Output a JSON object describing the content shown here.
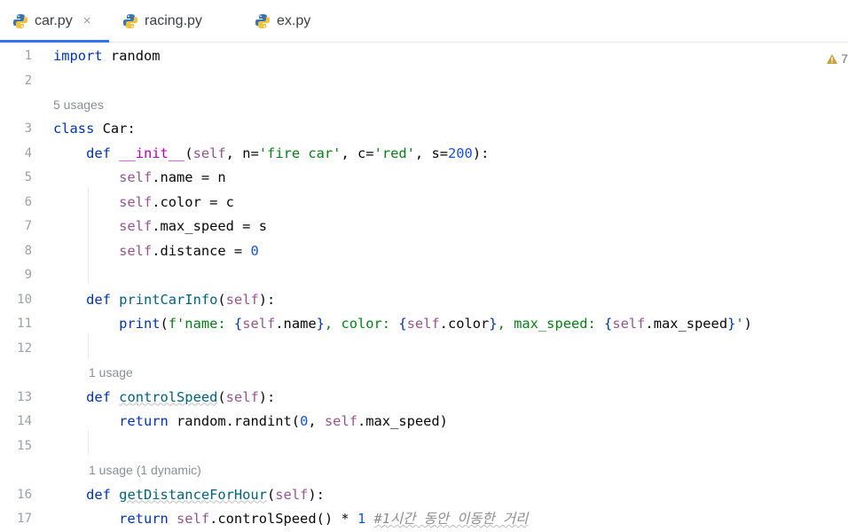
{
  "tabs": [
    {
      "label": "car.py",
      "active": true,
      "close": "×"
    },
    {
      "label": "racing.py",
      "active": false
    },
    {
      "label": "ex.py",
      "active": false
    }
  ],
  "warnings": {
    "count": "7"
  },
  "hints": {
    "class_car": "5 usages",
    "controlSpeed": "1 usage",
    "getDistanceForHour": "1 usage (1 dynamic)"
  },
  "code": {
    "import": "import",
    "random_mod": "random",
    "class_kw": "class",
    "class_name": "Car",
    "def_kw": "def",
    "init_name": "__init__",
    "self": "self",
    "param_n": "n",
    "str_fire_car": "'fire car'",
    "param_c": "c",
    "str_red": "'red'",
    "param_s": "s",
    "num_200": "200",
    "num_0": "0",
    "attr_name": "name",
    "attr_color": "color",
    "attr_max_speed": "max_speed",
    "attr_distance": "distance",
    "printCarInfo": "printCarInfo",
    "print": "print",
    "fstr_prefix": "f'name: ",
    "fstr_color": ", color: ",
    "fstr_max_speed": ", max_speed: ",
    "fstr_suffix": "'",
    "controlSpeed": "controlSpeed",
    "return": "return",
    "randint": "randint",
    "getDistanceForHour": "getDistanceForHour",
    "num_1": "1",
    "comment": "#1시간 동안 이동한 거리"
  },
  "line_numbers": [
    "1",
    "2",
    "3",
    "4",
    "5",
    "6",
    "7",
    "8",
    "9",
    "10",
    "11",
    "12",
    "13",
    "14",
    "15",
    "16",
    "17"
  ]
}
